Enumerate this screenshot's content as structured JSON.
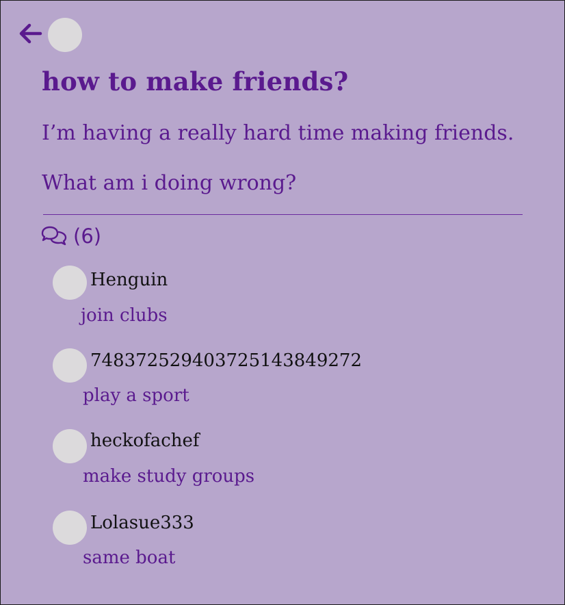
{
  "post": {
    "title": "how to make friends?",
    "body_lines": [
      "I’m having a really hard time making friends.",
      "What am i doing wrong?"
    ]
  },
  "comments_summary": {
    "count_label": "(6)",
    "icon": "comments-icon"
  },
  "comments": [
    {
      "username": "Henguin",
      "text": "join clubs"
    },
    {
      "username": "748372529403725143849272",
      "text": "play a sport"
    },
    {
      "username": "heckofachef",
      "text": "make study groups"
    },
    {
      "username": "Lolasue333",
      "text": "same boat"
    }
  ],
  "colors": {
    "background": "#b7a6cc",
    "accent": "#5a1a8e",
    "avatar": "#dcdadc"
  }
}
